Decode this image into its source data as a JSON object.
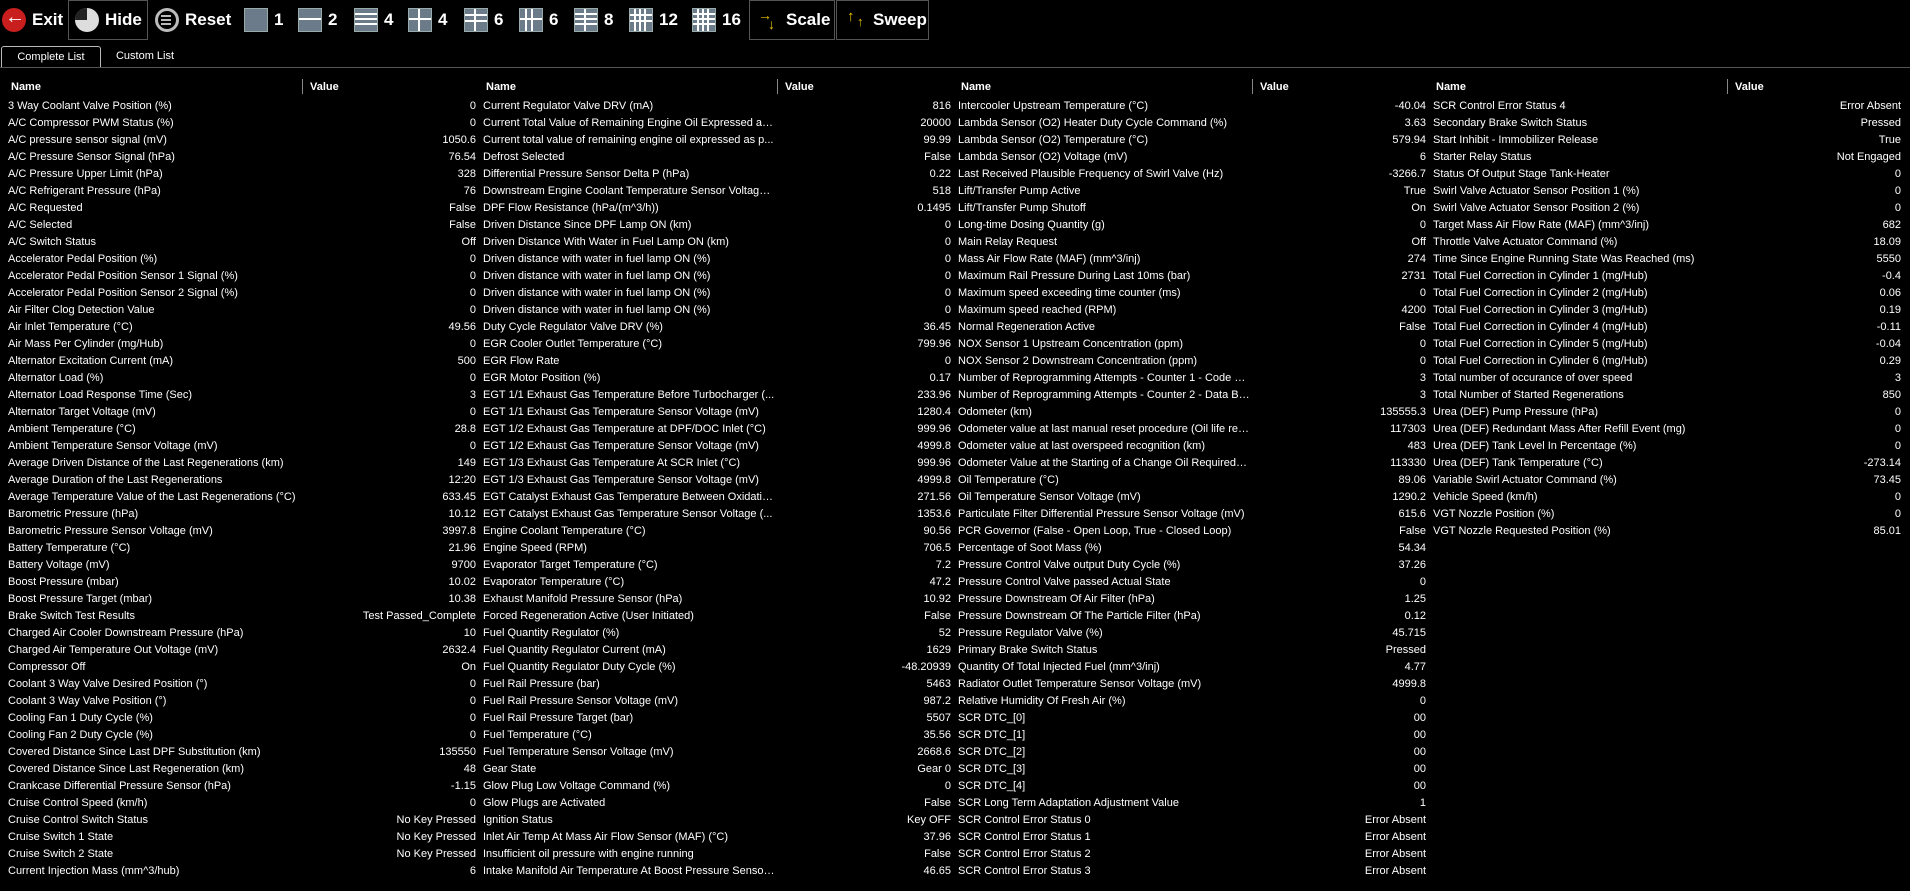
{
  "toolbar": {
    "exit": "Exit",
    "hide": "Hide",
    "reset": "Reset",
    "layouts": [
      "1",
      "2",
      "4",
      "4",
      "6",
      "6",
      "8",
      "12",
      "16"
    ],
    "scale": "Scale",
    "sweep": "Sweep"
  },
  "tabs": [
    "Complete List",
    "Custom List"
  ],
  "columns": {
    "name": "Name",
    "value": "Value"
  },
  "panels": [
    [
      [
        "3 Way Coolant Valve Position (%)",
        "0"
      ],
      [
        "A/C Compressor PWM Status (%)",
        "0"
      ],
      [
        "A/C pressure sensor signal (mV)",
        "1050.6"
      ],
      [
        "A/C Pressure Sensor Signal (hPa)",
        "76.54"
      ],
      [
        "A/C Pressure Upper Limit (hPa)",
        "328"
      ],
      [
        "A/C Refrigerant Pressure (hPa)",
        "76"
      ],
      [
        "A/C Requested",
        "False"
      ],
      [
        "A/C Selected",
        "False"
      ],
      [
        "A/C Switch Status",
        "Off"
      ],
      [
        "Accelerator Pedal Position (%)",
        "0"
      ],
      [
        "Accelerator Pedal Position Sensor 1 Signal (%)",
        "0"
      ],
      [
        "Accelerator Pedal Position Sensor 2 Signal (%)",
        "0"
      ],
      [
        "Air Filter Clog Detection Value",
        "0"
      ],
      [
        "Air Inlet Temperature (°C)",
        "49.56"
      ],
      [
        "Air Mass Per Cylinder (mg/Hub)",
        "0"
      ],
      [
        "Alternator Excitation Current (mA)",
        "500"
      ],
      [
        "Alternator Load (%)",
        "0"
      ],
      [
        "Alternator Load Response Time (Sec)",
        "3"
      ],
      [
        "Alternator Target Voltage (mV)",
        "0"
      ],
      [
        "Ambient Temperature (°C)",
        "28.8"
      ],
      [
        "Ambient Temperature Sensor Voltage (mV)",
        "0"
      ],
      [
        "Average Driven Distance of the Last Regenerations (km)",
        "149"
      ],
      [
        "Average Duration of the Last Regenerations",
        "12:20"
      ],
      [
        "Average Temperature Value of the Last Regenerations (°C)",
        "633.45"
      ],
      [
        "Barometric Pressure (hPa)",
        "10.12"
      ],
      [
        "Barometric Pressure Sensor Voltage (mV)",
        "3997.8"
      ],
      [
        "Battery Temperature (°C)",
        "21.96"
      ],
      [
        "Battery Voltage (mV)",
        "9700"
      ],
      [
        "Boost Pressure (mbar)",
        "10.02"
      ],
      [
        "Boost Pressure Target (mbar)",
        "10.38"
      ],
      [
        "Brake Switch Test Results",
        "Test Passed_Complete"
      ],
      [
        "Charged Air Cooler Downstream Pressure (hPa)",
        "10"
      ],
      [
        "Charged Air Temperature Out Voltage (mV)",
        "2632.4"
      ],
      [
        "Compressor Off",
        "On"
      ],
      [
        "Coolant 3 Way Valve Desired Position (°)",
        "0"
      ],
      [
        "Coolant 3 Way Valve Position (°)",
        "0"
      ],
      [
        "Cooling Fan 1 Duty Cycle (%)",
        "0"
      ],
      [
        "Cooling Fan 2 Duty Cycle (%)",
        "0"
      ],
      [
        "Covered Distance Since Last DPF Substitution (km)",
        "135550"
      ],
      [
        "Covered Distance Since Last Regeneration (km)",
        "48"
      ],
      [
        "Crankcase Differential Pressure Sensor (hPa)",
        "-1.15"
      ],
      [
        "Cruise Control Speed (km/h)",
        "0"
      ],
      [
        "Cruise Control Switch Status",
        "No Key Pressed"
      ],
      [
        "Cruise Switch 1 State",
        "No Key Pressed"
      ],
      [
        "Cruise Switch 2 State",
        "No Key Pressed"
      ],
      [
        "Current Injection Mass (mm^3/hub)",
        "6"
      ]
    ],
    [
      [
        "Current Regulator Valve DRV (mA)",
        "816"
      ],
      [
        "Current Total Value of Remaining Engine Oil Expressed as ...",
        "20000"
      ],
      [
        "Current total value of remaining engine oil expressed as p...",
        "99.99"
      ],
      [
        "Defrost Selected",
        "False"
      ],
      [
        "Differential Pressure Sensor Delta P (hPa)",
        "0.22"
      ],
      [
        "Downstream Engine Coolant Temperature Sensor Voltage ...",
        "518"
      ],
      [
        "DPF Flow Resistance (hPa/(m^3/h))",
        "0.1495"
      ],
      [
        "Driven Distance Since DPF Lamp ON (km)",
        "0"
      ],
      [
        "Driven Distance With Water in Fuel Lamp ON (km)",
        "0"
      ],
      [
        "Driven distance with water in fuel lamp ON (%)",
        "0"
      ],
      [
        "Driven distance with water in fuel lamp ON (%)",
        "0"
      ],
      [
        "Driven distance with water in fuel lamp ON (%)",
        "0"
      ],
      [
        "Driven distance with water in fuel lamp ON (%)",
        "0"
      ],
      [
        "Duty Cycle Regulator Valve DRV (%)",
        "36.45"
      ],
      [
        "EGR Cooler Outlet Temperature (°C)",
        "799.96"
      ],
      [
        "EGR Flow Rate",
        "0"
      ],
      [
        "EGR Motor Position (%)",
        "0.17"
      ],
      [
        "EGT 1/1 Exhaust Gas Temperature Before Turbocharger (...",
        "233.96"
      ],
      [
        "EGT 1/1 Exhaust Gas Temperature Sensor Voltage (mV)",
        "1280.4"
      ],
      [
        "EGT 1/2 Exhaust Gas Temperature at DPF/DOC Inlet (°C)",
        "999.96"
      ],
      [
        "EGT 1/2 Exhaust Gas Temperature Sensor Voltage (mV)",
        "4999.8"
      ],
      [
        "EGT 1/3 Exhaust Gas Temperature At SCR Inlet (°C)",
        "999.96"
      ],
      [
        "EGT 1/3 Exhaust Gas Temperature Sensor Voltage (mV)",
        "4999.8"
      ],
      [
        "EGT Catalyst Exhaust Gas Temperature Between Oxidatio...",
        "271.56"
      ],
      [
        "EGT Catalyst Exhaust Gas Temperature Sensor Voltage (...",
        "1353.6"
      ],
      [
        "Engine Coolant Temperature (°C)",
        "90.56"
      ],
      [
        "Engine Speed (RPM)",
        "706.5"
      ],
      [
        "Evaporator Target Temperature (°C)",
        "7.2"
      ],
      [
        "Evaporator Temperature (°C)",
        "47.2"
      ],
      [
        "Exhaust Manifold Pressure Sensor (hPa)",
        "10.92"
      ],
      [
        "Forced Regeneration Active (User Initiated)",
        "False"
      ],
      [
        "Fuel Quantity Regulator (%)",
        "52"
      ],
      [
        "Fuel Quantity Regulator Current (mA)",
        "1629"
      ],
      [
        "Fuel Quantity Regulator Duty Cycle (%)",
        "-48.20939"
      ],
      [
        "Fuel Rail Pressure (bar)",
        "5463"
      ],
      [
        "Fuel Rail Pressure Sensor Voltage (mV)",
        "987.2"
      ],
      [
        "Fuel Rail Pressure Target (bar)",
        "5507"
      ],
      [
        "Fuel Temperature (°C)",
        "35.56"
      ],
      [
        "Fuel Temperature Sensor Voltage (mV)",
        "2668.6"
      ],
      [
        "Gear State",
        "Gear 0"
      ],
      [
        "Glow Plug Low Voltage Command (%)",
        "0"
      ],
      [
        "Glow Plugs are Activated",
        "False"
      ],
      [
        "Ignition Status",
        "Key OFF"
      ],
      [
        "Inlet Air Temp At Mass Air Flow Sensor (MAF) (°C)",
        "37.96"
      ],
      [
        "Insufficient oil pressure with engine running",
        "False"
      ],
      [
        "Intake Manifold Air Temperature At Boost Pressure Sensor...",
        "46.65"
      ]
    ],
    [
      [
        "Intercooler Upstream Temperature (°C)",
        "-40.04"
      ],
      [
        "Lambda Sensor (O2) Heater Duty Cycle Command (%)",
        "3.63"
      ],
      [
        "Lambda Sensor (O2) Temperature (°C)",
        "579.94"
      ],
      [
        "Lambda Sensor (O2) Voltage (mV)",
        "6"
      ],
      [
        "Last Received Plausible Frequency of Swirl Valve (Hz)",
        "-3266.7"
      ],
      [
        "Lift/Transfer Pump Active",
        "True"
      ],
      [
        "Lift/Transfer Pump Shutoff",
        "On"
      ],
      [
        "Long-time Dosing Quantity (g)",
        "0"
      ],
      [
        "Main Relay Request",
        "Off"
      ],
      [
        "Mass Air Flow Rate (MAF) (mm^3/inj)",
        "274"
      ],
      [
        "Maximum Rail Pressure During Last 10ms (bar)",
        "2731"
      ],
      [
        "Maximum speed exceeding time counter (ms)",
        "0"
      ],
      [
        "Maximum speed reached (RPM)",
        "4200"
      ],
      [
        "Normal Regeneration Active",
        "False"
      ],
      [
        "NOX Sensor 1 Upstream Concentration (ppm)",
        "0"
      ],
      [
        "NOX Sensor 2 Downstream Concentration (ppm)",
        "0"
      ],
      [
        "Number of Reprogramming Attempts - Counter 1 - Code Bl...",
        "3"
      ],
      [
        "Number of Reprogramming Attempts - Counter 2 - Data Blo...",
        "3"
      ],
      [
        "Odometer (km)",
        "135555.3"
      ],
      [
        "Odometer value at last manual reset procedure (Oil life res...",
        "117303"
      ],
      [
        "Odometer value at last overspeed recognition (km)",
        "483"
      ],
      [
        "Odometer Value at the Starting of a Change Oil Required In...",
        "113330"
      ],
      [
        "Oil Temperature (°C)",
        "89.06"
      ],
      [
        "Oil Temperature Sensor Voltage (mV)",
        "1290.2"
      ],
      [
        "Particulate Filter Differential Pressure Sensor Voltage (mV)",
        "615.6"
      ],
      [
        "PCR Governor (False - Open Loop, True - Closed Loop)",
        "False"
      ],
      [
        "Percentage of Soot Mass (%)",
        "54.34"
      ],
      [
        "Pressure Control Valve output Duty Cycle (%)",
        "37.26"
      ],
      [
        "Pressure Control Valve passed Actual State",
        "0"
      ],
      [
        "Pressure Downstream Of Air Filter (hPa)",
        "1.25"
      ],
      [
        "Pressure Downstream Of The Particle Filter (hPa)",
        "0.12"
      ],
      [
        "Pressure Regulator Valve (%)",
        "45.715"
      ],
      [
        "Primary Brake Switch Status",
        "Pressed"
      ],
      [
        "Quantity Of Total Injected Fuel (mm^3/inj)",
        "4.77"
      ],
      [
        "Radiator Outlet Temperature Sensor Voltage (mV)",
        "4999.8"
      ],
      [
        "Relative Humidity Of Fresh Air (%)",
        "0"
      ],
      [
        "SCR DTC_[0]",
        "00"
      ],
      [
        "SCR DTC_[1]",
        "00"
      ],
      [
        "SCR DTC_[2]",
        "00"
      ],
      [
        "SCR DTC_[3]",
        "00"
      ],
      [
        "SCR DTC_[4]",
        "00"
      ],
      [
        "SCR Long Term Adaptation Adjustment Value",
        "1"
      ],
      [
        "SCR Control Error Status 0",
        "Error Absent"
      ],
      [
        "SCR Control Error Status 1",
        "Error Absent"
      ],
      [
        "SCR Control Error Status 2",
        "Error Absent"
      ],
      [
        "SCR Control Error Status 3",
        "Error Absent"
      ]
    ],
    [
      [
        "SCR Control Error Status 4",
        "Error Absent"
      ],
      [
        "Secondary Brake Switch Status",
        "Pressed"
      ],
      [
        "Start Inhibit - Immobilizer Release",
        "True"
      ],
      [
        "Starter Relay Status",
        "Not Engaged"
      ],
      [
        "Status Of Output Stage Tank-Heater",
        "0"
      ],
      [
        "Swirl Valve Actuator Sensor Position 1 (%)",
        "0"
      ],
      [
        "Swirl Valve Actuator Sensor Position 2 (%)",
        "0"
      ],
      [
        "Target Mass Air Flow Rate (MAF) (mm^3/inj)",
        "682"
      ],
      [
        "Throttle Valve Actuator Command (%)",
        "18.09"
      ],
      [
        "Time Since Engine Running State Was Reached (ms)",
        "5550"
      ],
      [
        "Total Fuel Correction in Cylinder 1 (mg/Hub)",
        "-0.4"
      ],
      [
        "Total Fuel Correction in Cylinder 2 (mg/Hub)",
        "0.06"
      ],
      [
        "Total Fuel Correction in Cylinder 3 (mg/Hub)",
        "0.19"
      ],
      [
        "Total Fuel Correction in Cylinder 4 (mg/Hub)",
        "-0.11"
      ],
      [
        "Total Fuel Correction in Cylinder 5 (mg/Hub)",
        "-0.04"
      ],
      [
        "Total Fuel Correction in Cylinder 6 (mg/Hub)",
        "0.29"
      ],
      [
        "Total number of occurance of over speed",
        "3"
      ],
      [
        "Total Number of Started Regenerations",
        "850"
      ],
      [
        "Urea (DEF) Pump Pressure (hPa)",
        "0"
      ],
      [
        "Urea (DEF) Redundant Mass After Refill Event (mg)",
        "0"
      ],
      [
        "Urea (DEF) Tank Level In Percentage (%)",
        "0"
      ],
      [
        "Urea (DEF) Tank Temperature (°C)",
        "-273.14"
      ],
      [
        "Variable Swirl Actuator Command (%)",
        "73.45"
      ],
      [
        "Vehicle Speed (km/h)",
        "0"
      ],
      [
        "VGT Nozzle Position (%)",
        "0"
      ],
      [
        "VGT Nozzle Requested Position (%)",
        "85.01"
      ]
    ]
  ]
}
